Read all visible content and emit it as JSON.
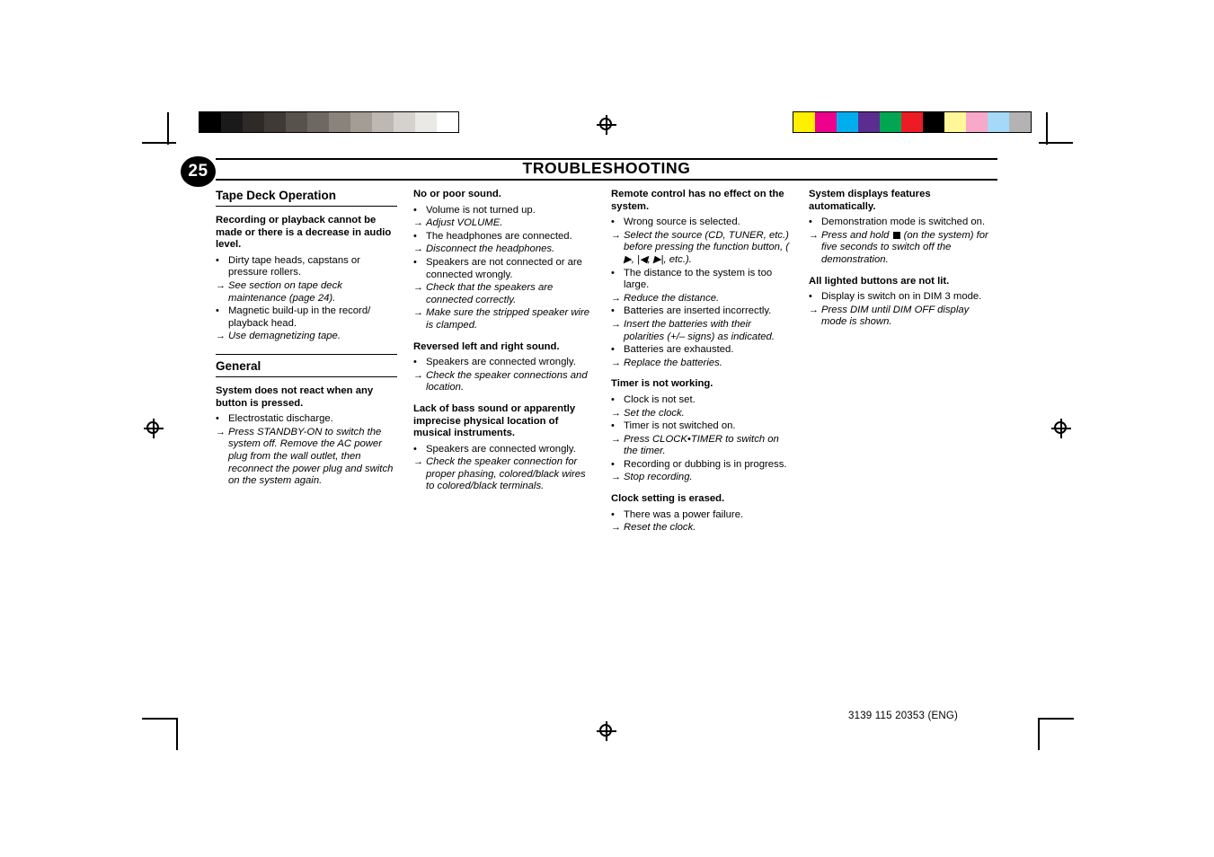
{
  "header": {
    "page_number": "25",
    "title": "TROUBLESHOOTING"
  },
  "footer": {
    "code": "3139 115 20353 (ENG)"
  },
  "colorbars": {
    "grayscale": [
      "#000000",
      "#1a1a1a",
      "#2e2a28",
      "#3f3a36",
      "#57524c",
      "#6e6862",
      "#8a837c",
      "#a39d96",
      "#bdb8b1",
      "#d5d2cd",
      "#ebe9e5",
      "#ffffff"
    ],
    "colors": [
      "#ffef00",
      "#ec008c",
      "#00aeef",
      "#5b2d90",
      "#00a651",
      "#ed1c24",
      "#000000",
      "#fff79a",
      "#f8a8c8",
      "#a6d9f7",
      "#b3b3b3"
    ]
  },
  "columns": [
    {
      "sections": [
        {
          "heading": "Tape Deck Operation",
          "rule": "thin",
          "blocks": [
            {
              "problem": "Recording or playback cannot be made or there is a decrease in audio level.",
              "items": [
                {
                  "type": "cause",
                  "text": "Dirty tape heads, capstans or pressure rollers."
                },
                {
                  "type": "solution",
                  "text": "See section on tape deck maintenance (page 24)."
                },
                {
                  "type": "cause",
                  "text": "Magnetic build-up in the record/ playback head."
                },
                {
                  "type": "solution",
                  "text": "Use demagnetizing tape."
                }
              ]
            }
          ]
        },
        {
          "heading": "General",
          "rule": "thin",
          "blocks": [
            {
              "problem": "System does not react when any button is pressed.",
              "items": [
                {
                  "type": "cause",
                  "text": "Electrostatic discharge."
                },
                {
                  "type": "solution",
                  "text": "Press STANDBY-ON to switch the system off. Remove the AC power plug from the wall outlet, then reconnect the power plug and switch on the system again."
                }
              ]
            }
          ]
        }
      ]
    },
    {
      "sections": [
        {
          "heading": "",
          "blocks": [
            {
              "problem": "No or poor sound.",
              "items": [
                {
                  "type": "cause",
                  "text": "Volume is not turned up."
                },
                {
                  "type": "solution",
                  "text": "Adjust VOLUME."
                },
                {
                  "type": "cause",
                  "text": "The headphones are connected."
                },
                {
                  "type": "solution",
                  "text": "Disconnect the headphones."
                },
                {
                  "type": "cause",
                  "text": "Speakers are not connected or are connected wrongly."
                },
                {
                  "type": "solution",
                  "text": "Check that the speakers are connected correctly."
                },
                {
                  "type": "solution",
                  "text": "Make sure the stripped speaker wire is clamped."
                }
              ]
            },
            {
              "problem": "Reversed left and right sound.",
              "items": [
                {
                  "type": "cause",
                  "text": "Speakers are connected wrongly."
                },
                {
                  "type": "solution",
                  "text": "Check the speaker connections and location."
                }
              ]
            },
            {
              "problem": "Lack of bass sound or apparently imprecise physical location of musical instruments.",
              "items": [
                {
                  "type": "cause",
                  "text": "Speakers are connected wrongly."
                },
                {
                  "type": "solution",
                  "text": "Check the speaker connection for proper phasing, colored/black wires to colored/black terminals."
                }
              ]
            }
          ]
        }
      ]
    },
    {
      "sections": [
        {
          "heading": "",
          "blocks": [
            {
              "problem": "Remote control has no effect on the system.",
              "items": [
                {
                  "type": "cause",
                  "text": "Wrong source is selected."
                },
                {
                  "type": "solution",
                  "text": "Select the source (CD, TUNER, etc.) before pressing the function button, ( ▶, |◀, ▶|, etc.)."
                },
                {
                  "type": "cause",
                  "text": "The distance to the system is too large."
                },
                {
                  "type": "solution",
                  "text": "Reduce the distance."
                },
                {
                  "type": "cause",
                  "text": "Batteries are inserted incorrectly."
                },
                {
                  "type": "solution",
                  "text": "Insert the batteries with their polarities (+/– signs) as indicated."
                },
                {
                  "type": "cause",
                  "text": "Batteries are exhausted."
                },
                {
                  "type": "solution",
                  "text": "Replace the batteries."
                }
              ]
            },
            {
              "problem": "Timer is not working.",
              "items": [
                {
                  "type": "cause",
                  "text": "Clock is not set."
                },
                {
                  "type": "solution",
                  "text": "Set the clock."
                },
                {
                  "type": "cause",
                  "text": "Timer is not switched on."
                },
                {
                  "type": "solution",
                  "text": "Press CLOCK•TIMER to switch on the timer."
                },
                {
                  "type": "cause",
                  "text": "Recording or dubbing is in progress."
                },
                {
                  "type": "solution",
                  "text": "Stop recording."
                }
              ]
            },
            {
              "problem": "Clock setting is erased.",
              "items": [
                {
                  "type": "cause",
                  "text": "There was a power failure."
                },
                {
                  "type": "solution",
                  "text": "Reset the clock."
                }
              ]
            }
          ]
        }
      ]
    },
    {
      "sections": [
        {
          "heading": "",
          "blocks": [
            {
              "problem": "System displays features automatically.",
              "items": [
                {
                  "type": "cause",
                  "text": "Demonstration mode is switched on."
                },
                {
                  "type": "solution",
                  "html": "Press and hold <span class=\"sq-glyph\"></span> (on the system) for five seconds to switch off the demonstration."
                }
              ]
            },
            {
              "problem": "All lighted buttons are not lit.",
              "items": [
                {
                  "type": "cause",
                  "text": "Display is switch on in DIM 3 mode."
                },
                {
                  "type": "solution",
                  "text": "Press DIM until DIM OFF display mode is shown."
                }
              ]
            }
          ]
        }
      ]
    }
  ]
}
